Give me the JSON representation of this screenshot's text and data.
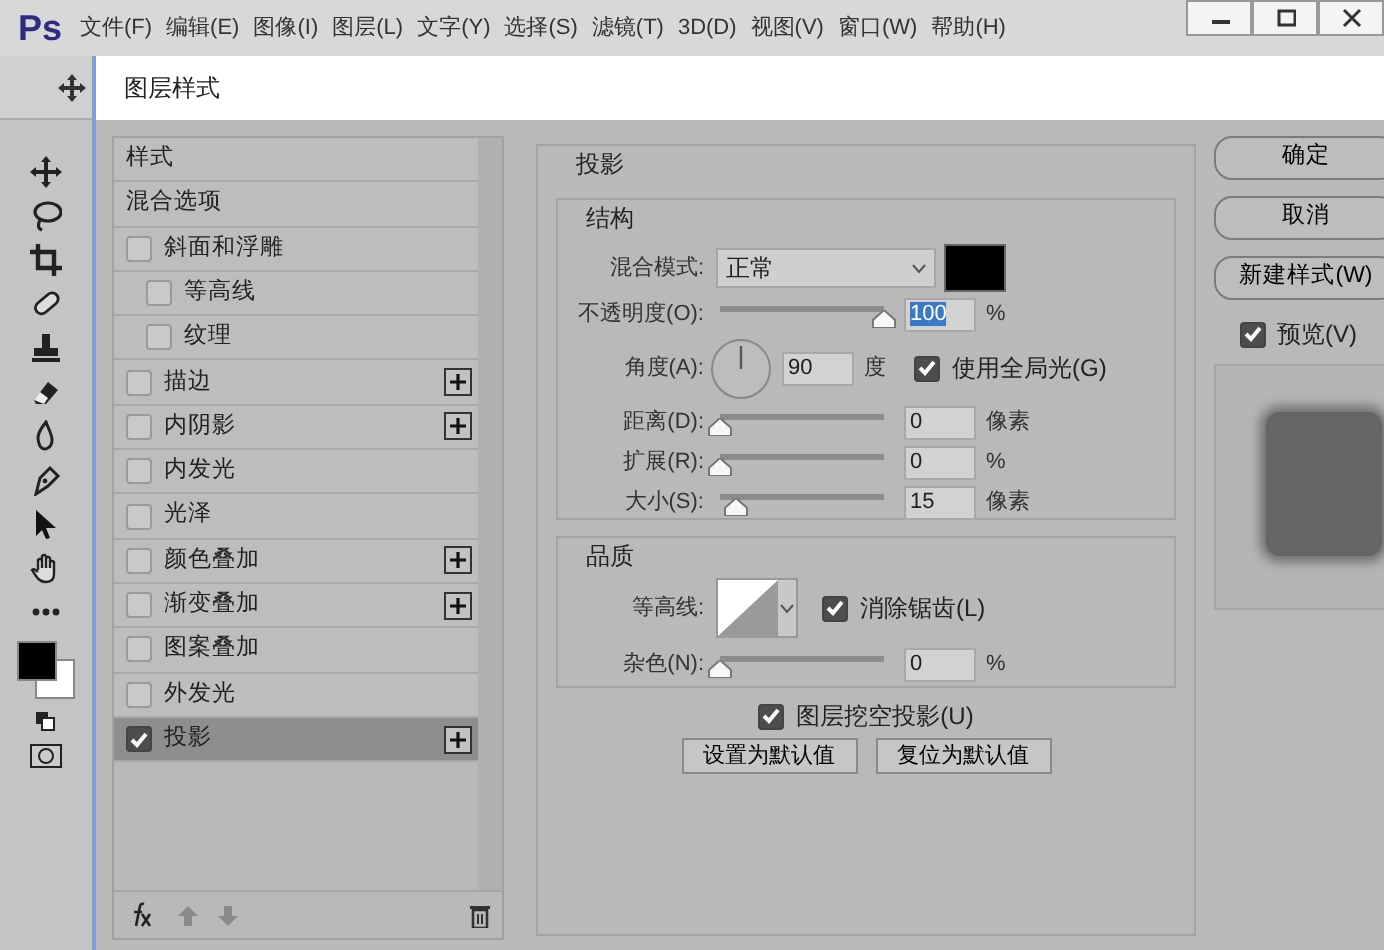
{
  "app": {
    "logo": "Ps",
    "menu": [
      "文件(F)",
      "编辑(E)",
      "图像(I)",
      "图层(L)",
      "文字(Y)",
      "选择(S)",
      "滤镜(T)",
      "3D(D)",
      "视图(V)",
      "窗口(W)",
      "帮助(H)"
    ]
  },
  "dialog": {
    "title": "图层样式"
  },
  "styles_list": [
    {
      "label": "样式",
      "kind": "heading",
      "selected": false
    },
    {
      "label": "混合选项",
      "kind": "heading",
      "selected": false
    },
    {
      "label": "斜面和浮雕",
      "kind": "effect",
      "checked": false,
      "selected": false,
      "add": false,
      "children": [
        {
          "label": "等高线",
          "kind": "effect",
          "checked": false,
          "selected": false,
          "add": false
        },
        {
          "label": "纹理",
          "kind": "effect",
          "checked": false,
          "selected": false,
          "add": false
        }
      ]
    },
    {
      "label": "描边",
      "kind": "effect",
      "checked": false,
      "selected": false,
      "add": true
    },
    {
      "label": "内阴影",
      "kind": "effect",
      "checked": false,
      "selected": false,
      "add": true
    },
    {
      "label": "内发光",
      "kind": "effect",
      "checked": false,
      "selected": false,
      "add": false
    },
    {
      "label": "光泽",
      "kind": "effect",
      "checked": false,
      "selected": false,
      "add": false
    },
    {
      "label": "颜色叠加",
      "kind": "effect",
      "checked": false,
      "selected": false,
      "add": true
    },
    {
      "label": "渐变叠加",
      "kind": "effect",
      "checked": false,
      "selected": false,
      "add": true
    },
    {
      "label": "图案叠加",
      "kind": "effect",
      "checked": false,
      "selected": false,
      "add": false
    },
    {
      "label": "外发光",
      "kind": "effect",
      "checked": false,
      "selected": false,
      "add": false
    },
    {
      "label": "投影",
      "kind": "effect",
      "checked": true,
      "selected": true,
      "add": true
    }
  ],
  "panel": {
    "title": "投影",
    "structure": {
      "title": "结构",
      "blend_mode": {
        "label": "混合模式:",
        "value": "正常"
      },
      "opacity": {
        "label": "不透明度(O):",
        "level": 1,
        "value": "100",
        "text_selected": true,
        "unit": "%"
      },
      "angle": {
        "label": "角度(A):",
        "value": "90",
        "unit": "度"
      },
      "global_light": {
        "label": "使用全局光(G)",
        "checked": true
      },
      "distance": {
        "label": "距离(D):",
        "level": 0,
        "value": "0",
        "unit": "像素"
      },
      "spread": {
        "label": "扩展(R):",
        "level": 0,
        "value": "0",
        "unit": "%"
      },
      "size": {
        "label": "大小(S):",
        "level": 0.1,
        "value": "15",
        "unit": "像素"
      }
    },
    "quality": {
      "title": "品质",
      "contour": {
        "label": "等高线:"
      },
      "anti_alias": {
        "label": "消除锯齿(L)",
        "checked": true
      },
      "noise": {
        "label": "杂色(N):",
        "level": 0,
        "value": "0",
        "unit": "%"
      }
    },
    "knockout": {
      "label": "图层挖空投影(U)",
      "checked": true
    },
    "buttons": [
      "设置为默认值",
      "复位为默认值"
    ]
  },
  "side_buttons": [
    "确定",
    "取消",
    "新建样式(W)"
  ],
  "preview": {
    "label": "预览(V)",
    "checked": true
  }
}
